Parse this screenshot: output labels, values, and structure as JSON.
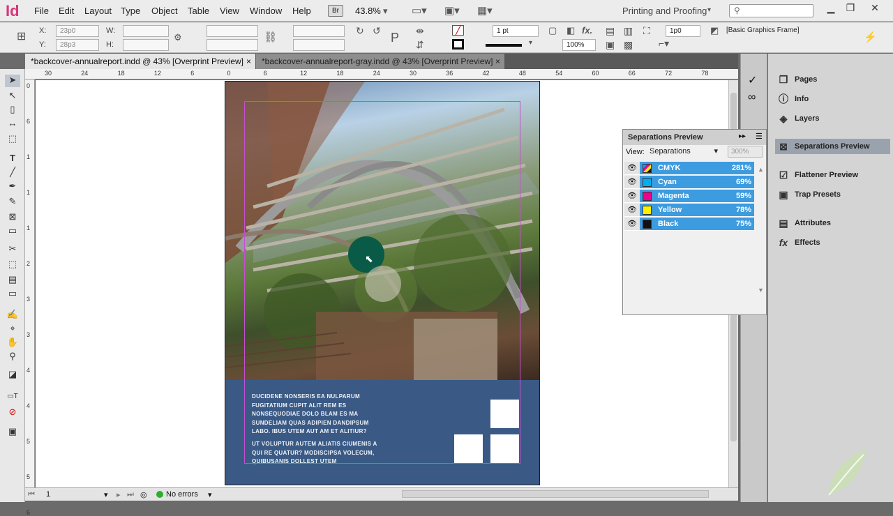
{
  "app": {
    "logo": "Id"
  },
  "menubar": {
    "items": [
      "File",
      "Edit",
      "Layout",
      "Type",
      "Object",
      "Table",
      "View",
      "Window",
      "Help"
    ],
    "bridge_badge": "Br",
    "zoom": "43.8%",
    "workspace": "Printing and Proofing",
    "search_placeholder": ""
  },
  "control": {
    "x_label": "X:",
    "x_value": "23p0",
    "y_label": "Y:",
    "y_value": "28p3",
    "w_label": "W:",
    "h_label": "H:",
    "stroke_weight": "1 pt",
    "opacity": "100%",
    "offset": "1p0",
    "frame_style": "[Basic Graphics Frame]"
  },
  "tabs": [
    {
      "label": "*backcover-annualreport.indd @ 43% [Overprint Preview]",
      "close": "×"
    },
    {
      "label": "*backcover-annualreport-gray.indd @ 43% [Overprint Preview]",
      "close": "×"
    }
  ],
  "ruler": {
    "h": [
      "30",
      "24",
      "18",
      "12",
      "6",
      "0",
      "6",
      "12",
      "18",
      "24",
      "30",
      "36",
      "42",
      "48",
      "54",
      "60",
      "66",
      "72",
      "78"
    ],
    "v": [
      "0",
      "6",
      "1",
      "1",
      "1",
      "2",
      "3",
      "3",
      "4",
      "4",
      "5",
      "5",
      "6"
    ]
  },
  "document": {
    "paragraph1": "DUCIDENE NONSERIS EA NULPARUM FUGITATIUM CUPIT ALIT REM ES NONSEQUODIAE DOLO BLAM ES MA SUNDELIAM QUAS ADIPIEN DANDIPSUM LABO. IBUS UTEM AUT AM ET ALITIUR?",
    "paragraph2": "UT VOLUPTUR AUTEM ALIATIS CIUMENIS A QUI RE QUATUR? MODISCIPSA VOLECUM, QUIBUSANIS DOLLEST UTEM"
  },
  "status": {
    "page": "1",
    "preflight": "No errors"
  },
  "dock": {
    "items": [
      "Pages",
      "Info",
      "Layers",
      "Separations Preview",
      "Flattener Preview",
      "Trap Presets",
      "Attributes",
      "Effects"
    ],
    "active": "Separations Preview"
  },
  "separations": {
    "title": "Separations Preview",
    "view_label": "View:",
    "view_value": "Separations",
    "zoom_value": "300%",
    "rows": [
      {
        "name": "CMYK",
        "pct": "281%",
        "color": "#2a2a2a"
      },
      {
        "name": "Cyan",
        "pct": "69%",
        "color": "#00aeef"
      },
      {
        "name": "Magenta",
        "pct": "59%",
        "color": "#ec008c"
      },
      {
        "name": "Yellow",
        "pct": "78%",
        "color": "#fff200"
      },
      {
        "name": "Black",
        "pct": "75%",
        "color": "#111111"
      }
    ]
  },
  "colors": {
    "accent": "#3d9be0",
    "cover_band": "#3a5a85",
    "logo": "#d8377a"
  }
}
